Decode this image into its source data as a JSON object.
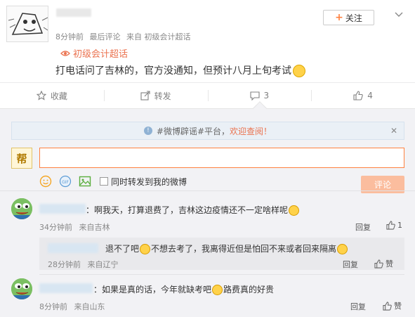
{
  "post": {
    "time": "8分钟前",
    "last_comment": "最后评论",
    "source": "来自 初级会计超话",
    "topic": "初级会计超话",
    "text": "打电话问了吉林的，官方没通知，但预计八月上旬考试",
    "follow_label": "关注"
  },
  "actions": {
    "favorite": "收藏",
    "repost": "转发",
    "comment_count": "3",
    "like_count": "4"
  },
  "notice": {
    "prefix": "#微博辟谣#平台，",
    "link": "欢迎查阅！"
  },
  "composer": {
    "avatar_char": "帮",
    "repost_label": "同时转发到我的微博",
    "submit_label": "评论"
  },
  "comments": [
    {
      "text": "：啊我天，打算退费了，吉林这边疫情还不一定啥样呢",
      "time": "34分钟前",
      "source": "来自吉林",
      "reply_label": "回复",
      "likes": "1"
    },
    {
      "text": "：如果是真的话，今年就缺考吧",
      "text_after": "路费真的好贵",
      "time": "8分钟前",
      "source": "来自山东",
      "reply_label": "回复",
      "likes": "赞"
    }
  ],
  "nested_reply": {
    "text": "退不了吧",
    "text_mid": "不想去考了，我离得近但是怕回不来或者回来隔离",
    "time": "28分钟前",
    "source": "来自辽宁",
    "reply_label": "回复",
    "likes": "赞"
  },
  "colors": {
    "accent": "#eb7350",
    "input_border": "#ff8140",
    "submit_bg": "#fbbd9e"
  }
}
